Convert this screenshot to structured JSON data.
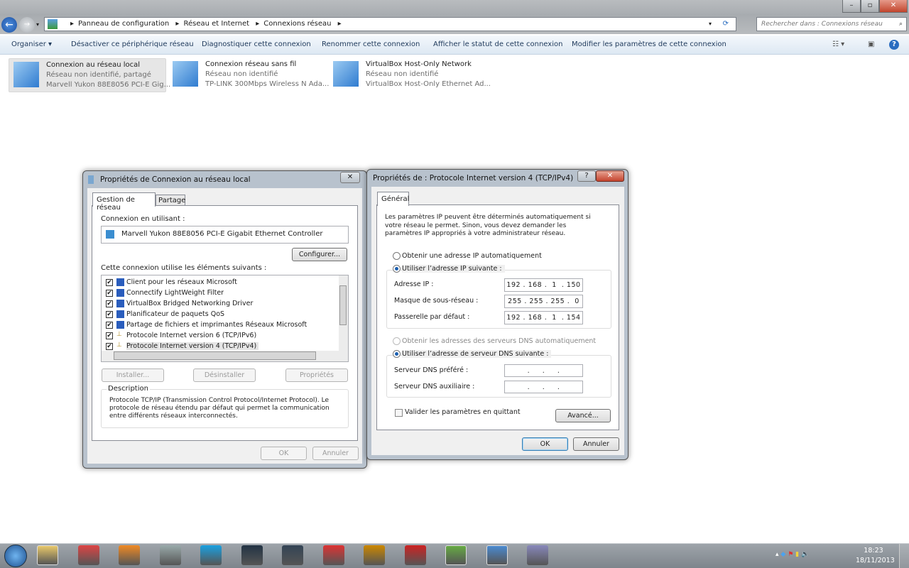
{
  "explorer": {
    "breadcrumb": [
      "Panneau de configuration",
      "Réseau et Internet",
      "Connexions réseau"
    ],
    "search_placeholder": "Rechercher dans : Connexions réseau",
    "toolbar": [
      "Organiser ▾",
      "Désactiver ce périphérique réseau",
      "Diagnostiquer cette connexion",
      "Renommer cette connexion",
      "Afficher le statut de cette connexion",
      "Modifier les paramètres de cette connexion"
    ],
    "connections": [
      {
        "name": "Connexion au réseau local",
        "status": "Réseau non identifié, partagé",
        "device": "Marvell Yukon 88E8056 PCI-E Gig..."
      },
      {
        "name": "Connexion réseau sans fil",
        "status": "Réseau non identifié",
        "device": "TP-LINK 300Mbps Wireless N Ada..."
      },
      {
        "name": "VirtualBox Host-Only Network",
        "status": "Réseau non identifié",
        "device": "VirtualBox Host-Only Ethernet Ad..."
      }
    ]
  },
  "dialog1": {
    "title": "Propriétés de Connexion au réseau local",
    "tabs": [
      "Gestion de réseau",
      "Partage"
    ],
    "connect_using_label": "Connexion en utilisant :",
    "adapter": "Marvell Yukon 88E8056 PCI-E Gigabit Ethernet Controller",
    "configure": "Configurer...",
    "items_label": "Cette connexion utilise les éléments suivants :",
    "items": [
      "Client pour les réseaux Microsoft",
      "Connectify LightWeight Filter",
      "VirtualBox Bridged Networking Driver",
      "Planificateur de paquets QoS",
      "Partage de fichiers et imprimantes Réseaux Microsoft",
      "Protocole Internet version 6 (TCP/IPv6)",
      "Protocole Internet version 4 (TCP/IPv4)"
    ],
    "install": "Installer...",
    "uninstall": "Désinstaller",
    "properties": "Propriétés",
    "description_label": "Description",
    "description": "Protocole TCP/IP (Transmission Control Protocol/Internet Protocol). Le protocole de réseau étendu par défaut qui permet la communication entre différents réseaux interconnectés.",
    "ok": "OK",
    "cancel": "Annuler"
  },
  "dialog2": {
    "title": "Propriétés de : Protocole Internet version 4 (TCP/IPv4)",
    "tab": "Général",
    "intro": "Les paramètres IP peuvent être déterminés automatiquement si votre réseau le permet. Sinon, vous devez demander les paramètres IP appropriés à votre administrateur réseau.",
    "auto_ip": "Obtenir une adresse IP automatiquement",
    "manual_ip": "Utiliser l’adresse IP suivante :",
    "ip_label": "Adresse IP :",
    "ip": "192 . 168 .  1  . 150",
    "mask_label": "Masque de sous-réseau :",
    "mask": "255 . 255 . 255 .  0",
    "gw_label": "Passerelle par défaut :",
    "gw": "192 . 168 .  1  . 154",
    "auto_dns": "Obtenir les adresses des serveurs DNS automatiquement",
    "manual_dns": "Utiliser l’adresse de serveur DNS suivante :",
    "dns1_label": "Serveur DNS préféré :",
    "dns1": "  .     .     .  ",
    "dns2_label": "Serveur DNS auxiliaire :",
    "dns2": "  .     .     .  ",
    "validate": "Valider les paramètres en quittant",
    "advanced": "Avancé...",
    "ok": "OK",
    "cancel": "Annuler"
  },
  "taskbar": {
    "time": "18:23",
    "date": "18/11/2013"
  }
}
